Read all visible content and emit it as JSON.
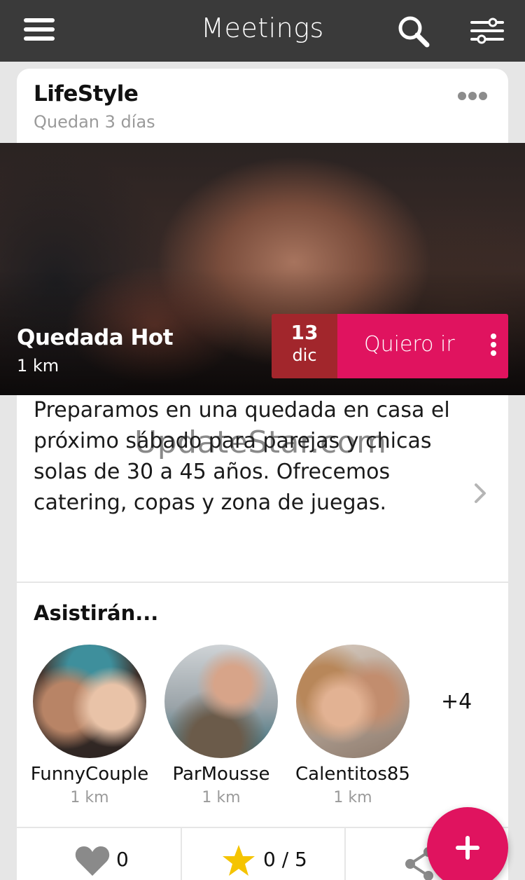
{
  "topbar": {
    "title": "Meetings",
    "menu_icon": "hamburger-menu-icon",
    "search_icon": "search-icon",
    "filter_icon": "filter-sliders-icon"
  },
  "group": {
    "name": "LifeStyle",
    "time_left": "Quedan 3 días",
    "more_icon": "more-dots-icon"
  },
  "event": {
    "title": "Quedada Hot",
    "distance": "1 km",
    "date_day": "13",
    "date_month": "dic",
    "attend_label": "Quiero ir",
    "description": "Preparamos en una quedada en casa el próximo sábado para parejas y chicas solas de 30 a 45 años. Ofrecemos catering, copas y zona de juegas."
  },
  "watermark": "UpdateStar.com",
  "attendees": {
    "title": "Asistirán...",
    "items": [
      {
        "name": "FunnyCouple",
        "distance": "1 km"
      },
      {
        "name": "ParMousse",
        "distance": "1 km"
      },
      {
        "name": "Calentitos85",
        "distance": "1 km"
      }
    ],
    "more": "+4"
  },
  "actions": {
    "likes": "0",
    "rating": "0 / 5",
    "share_icon": "share-icon"
  },
  "colors": {
    "accent": "#e0135f",
    "date_bg": "#a2262c",
    "topbar": "#3a3a3a",
    "star": "#f5c400"
  }
}
